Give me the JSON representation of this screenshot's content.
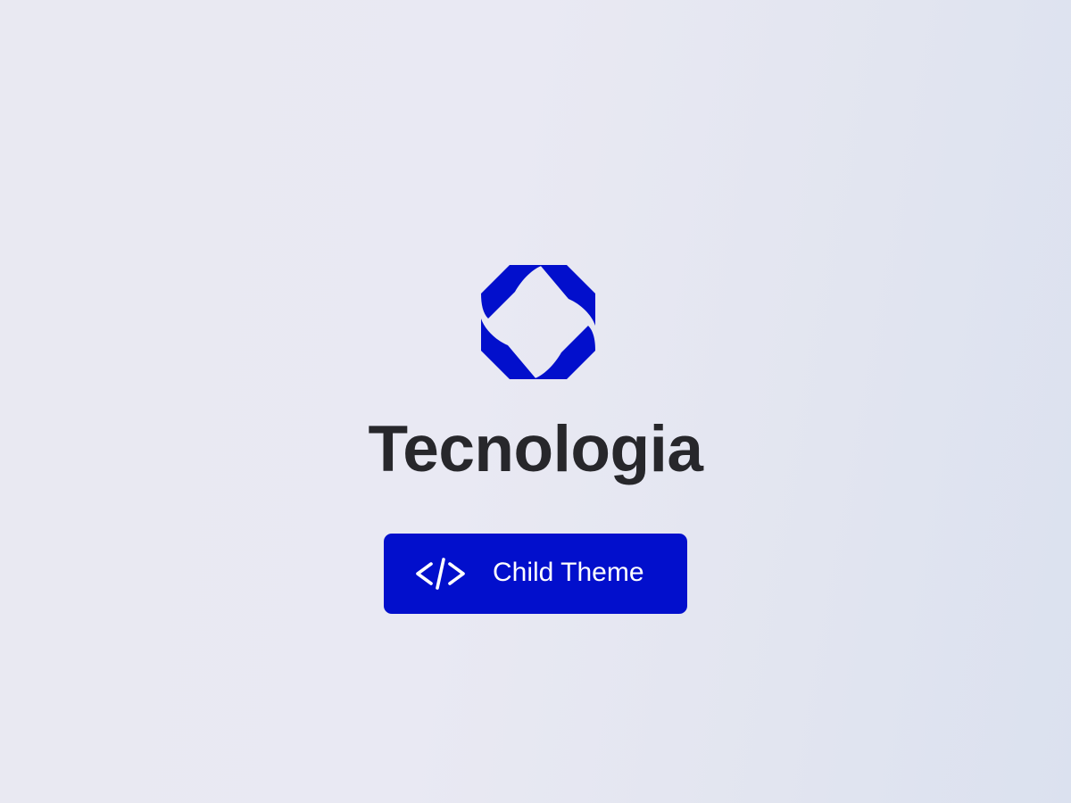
{
  "brand": {
    "name": "Tecnologia",
    "logo_icon": "octagon-ribbon-logo-icon",
    "accent_color": "#020fcc",
    "text_color": "#27272b"
  },
  "cta": {
    "label": "Child Theme",
    "icon": "code-icon"
  }
}
